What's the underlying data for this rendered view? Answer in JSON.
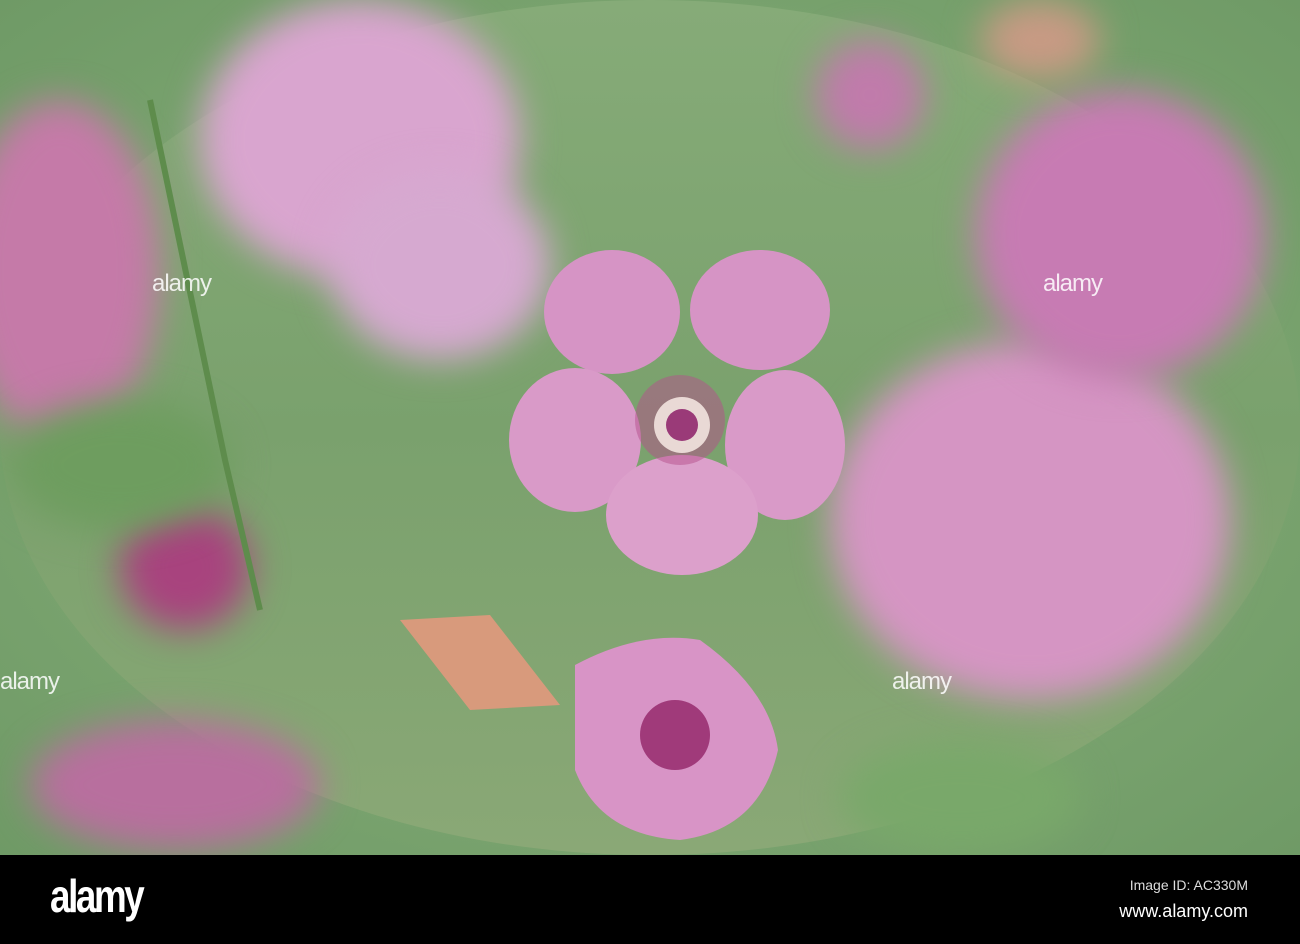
{
  "photo": {
    "subject": "pink flowers"
  },
  "watermark": {
    "text": "alamy"
  },
  "footer": {
    "logo": "alamy",
    "image_id": "Image ID: AC330M",
    "website": "www.alamy.com"
  },
  "colors": {
    "petal": "#d98fc4",
    "vein": "#b0306f",
    "leaf": "#7fae6e",
    "bar": "#000000"
  }
}
